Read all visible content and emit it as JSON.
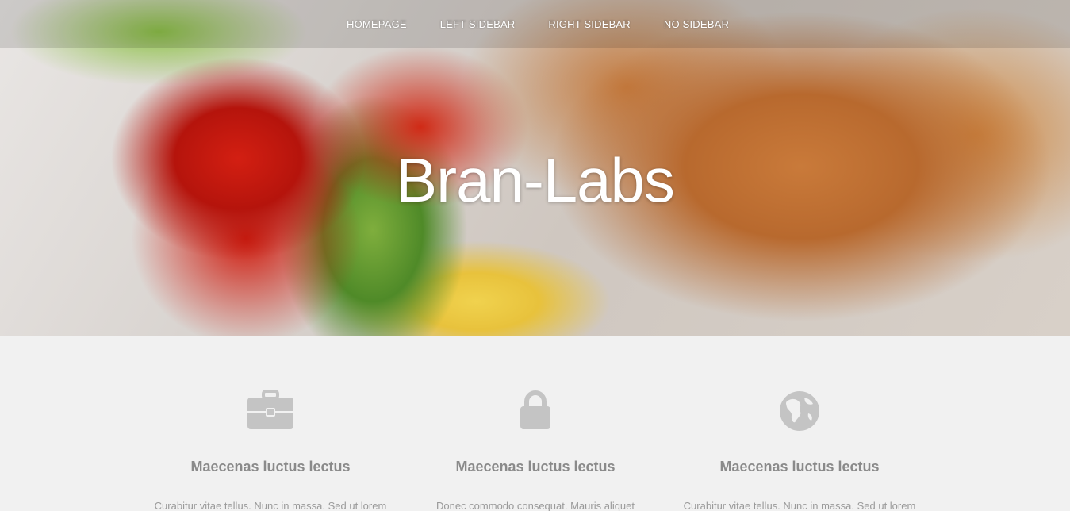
{
  "nav": {
    "items": [
      {
        "label": "HOMEPAGE"
      },
      {
        "label": "LEFT SIDEBAR"
      },
      {
        "label": "RIGHT SIDEBAR"
      },
      {
        "label": "NO SIDEBAR"
      }
    ]
  },
  "hero": {
    "title": "Bran-Labs"
  },
  "features": [
    {
      "icon": "briefcase-icon",
      "title": "Maecenas luctus lectus",
      "text": "Curabitur vitae tellus. Nunc in massa. Sed ut lorem"
    },
    {
      "icon": "lock-icon",
      "title": "Maecenas luctus lectus",
      "text": "Donec commodo consequat. Mauris aliquet"
    },
    {
      "icon": "globe-icon",
      "title": "Maecenas luctus lectus",
      "text": "Curabitur vitae tellus. Nunc in massa. Sed ut lorem"
    }
  ],
  "colors": {
    "icon": "#c4c4c4",
    "feature_title": "#8a8a8a",
    "background": "#f1f1f1"
  }
}
